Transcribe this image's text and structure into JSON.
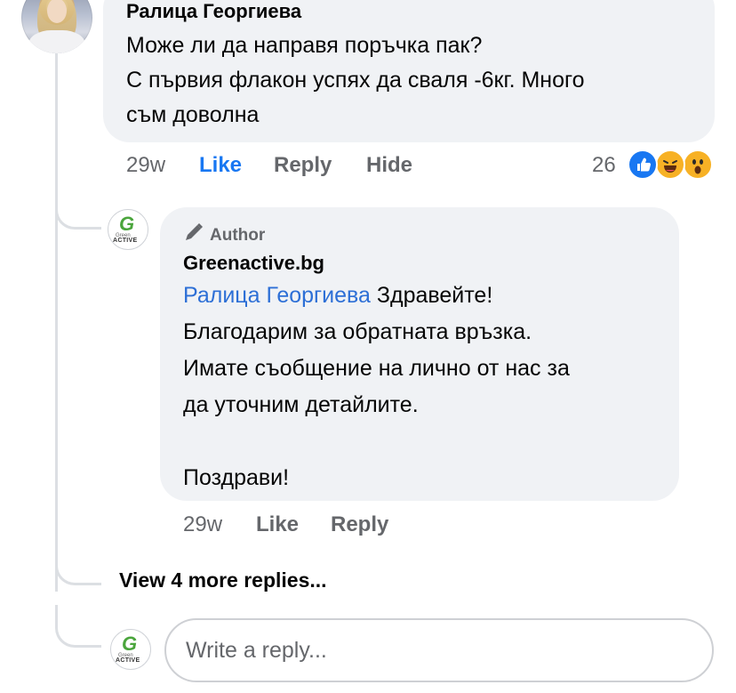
{
  "comment": {
    "author": "Ралица Георгиева",
    "text_lines": [
      "Може ли да направя поръчка пак?",
      "С първия флакон успях да сваля -6кг. Много",
      "съм доволна"
    ],
    "time": "29w",
    "like_label": "Like",
    "reply_label": "Reply",
    "hide_label": "Hide",
    "reaction_count": "26",
    "reactions": [
      "like-icon",
      "haha-icon",
      "wow-icon"
    ]
  },
  "reply": {
    "badge": "Author",
    "author": "Greenactive.bg",
    "mention": "Ралица Георгиева",
    "first_line_rest": " Здравейте!",
    "text_lines": [
      "Благодарим за обратната връзка.",
      "Имате съобщение на лично от нас за",
      "да уточним детайлите.",
      "",
      "Поздрави!"
    ],
    "time": "29w",
    "like_label": "Like",
    "reply_label": "Reply"
  },
  "logo": {
    "letter": "G",
    "small_text": "Green",
    "active_text": "ACTIVE",
    "brand_color": "#4aa53c"
  },
  "view_more": "View 4 more replies...",
  "write_reply_placeholder": "Write a reply...",
  "colors": {
    "link_blue": "#1877f2",
    "mention_blue": "#2d6fd6",
    "bubble_bg": "#f0f2f5",
    "secondary_text": "#65676b"
  }
}
